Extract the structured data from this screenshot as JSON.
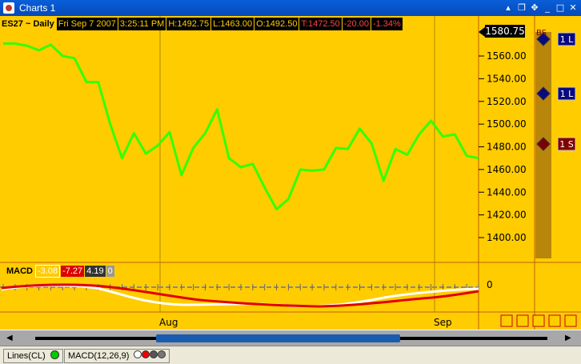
{
  "window": {
    "title": "Charts 1"
  },
  "header": {
    "symbol": "ES27 ~ Daily",
    "date": "Fri Sep 7 2007",
    "time": "3:25:11 PM",
    "high": "H:1492.75",
    "low": "L:1463.00",
    "open": "O:1492.50",
    "last": "T:1472.50",
    "change": "-20.00",
    "change_pct": "-1.34%"
  },
  "price_axis": {
    "current_label": "1580.75",
    "ticks": [
      "1560.00",
      "1540.00",
      "1520.00",
      "1500.00",
      "1480.00",
      "1460.00",
      "1440.00",
      "1420.00",
      "1400.00"
    ]
  },
  "macd": {
    "label": "MACD",
    "v1": "-3.08",
    "v2": "-7.27",
    "v3": "4.19",
    "v4": "0",
    "zero_label": "0"
  },
  "time_axis": {
    "labels": [
      "Aug",
      "Sep"
    ]
  },
  "orders": {
    "column_label": "BS",
    "items": [
      {
        "label": "1 L",
        "color": "#0a0a80"
      },
      {
        "label": "1 L",
        "color": "#0a0a80"
      },
      {
        "label": "1 S",
        "color": "#800000"
      }
    ]
  },
  "status": {
    "lines_label": "Lines(CL)",
    "macd_label": "MACD(12,26,9)"
  },
  "colors": {
    "background": "#ffcc00",
    "price_line": "#33ff00",
    "macd_line": "#ff0000",
    "signal_line": "#ffffff",
    "scroll_thumb": "#1a5bb0"
  },
  "chart_data": {
    "type": "line",
    "title": "",
    "xlabel": "",
    "ylabel": "",
    "ylim": [
      1390,
      1585
    ],
    "x_labels": [
      "Aug",
      "Sep"
    ],
    "series": [
      {
        "values": [
          1571,
          1571,
          1569,
          1565,
          1570,
          1560,
          1558,
          1537,
          1537,
          1500,
          1470,
          1492,
          1474,
          1481,
          1493,
          1455,
          1479,
          1492,
          1513,
          1470,
          1462,
          1465,
          1444,
          1425,
          1434,
          1460,
          1459,
          1460,
          1479,
          1478,
          1496,
          1483,
          1450,
          1478,
          1473,
          1491,
          1503,
          1489,
          1491,
          1472,
          1470
        ]
      }
    ]
  }
}
